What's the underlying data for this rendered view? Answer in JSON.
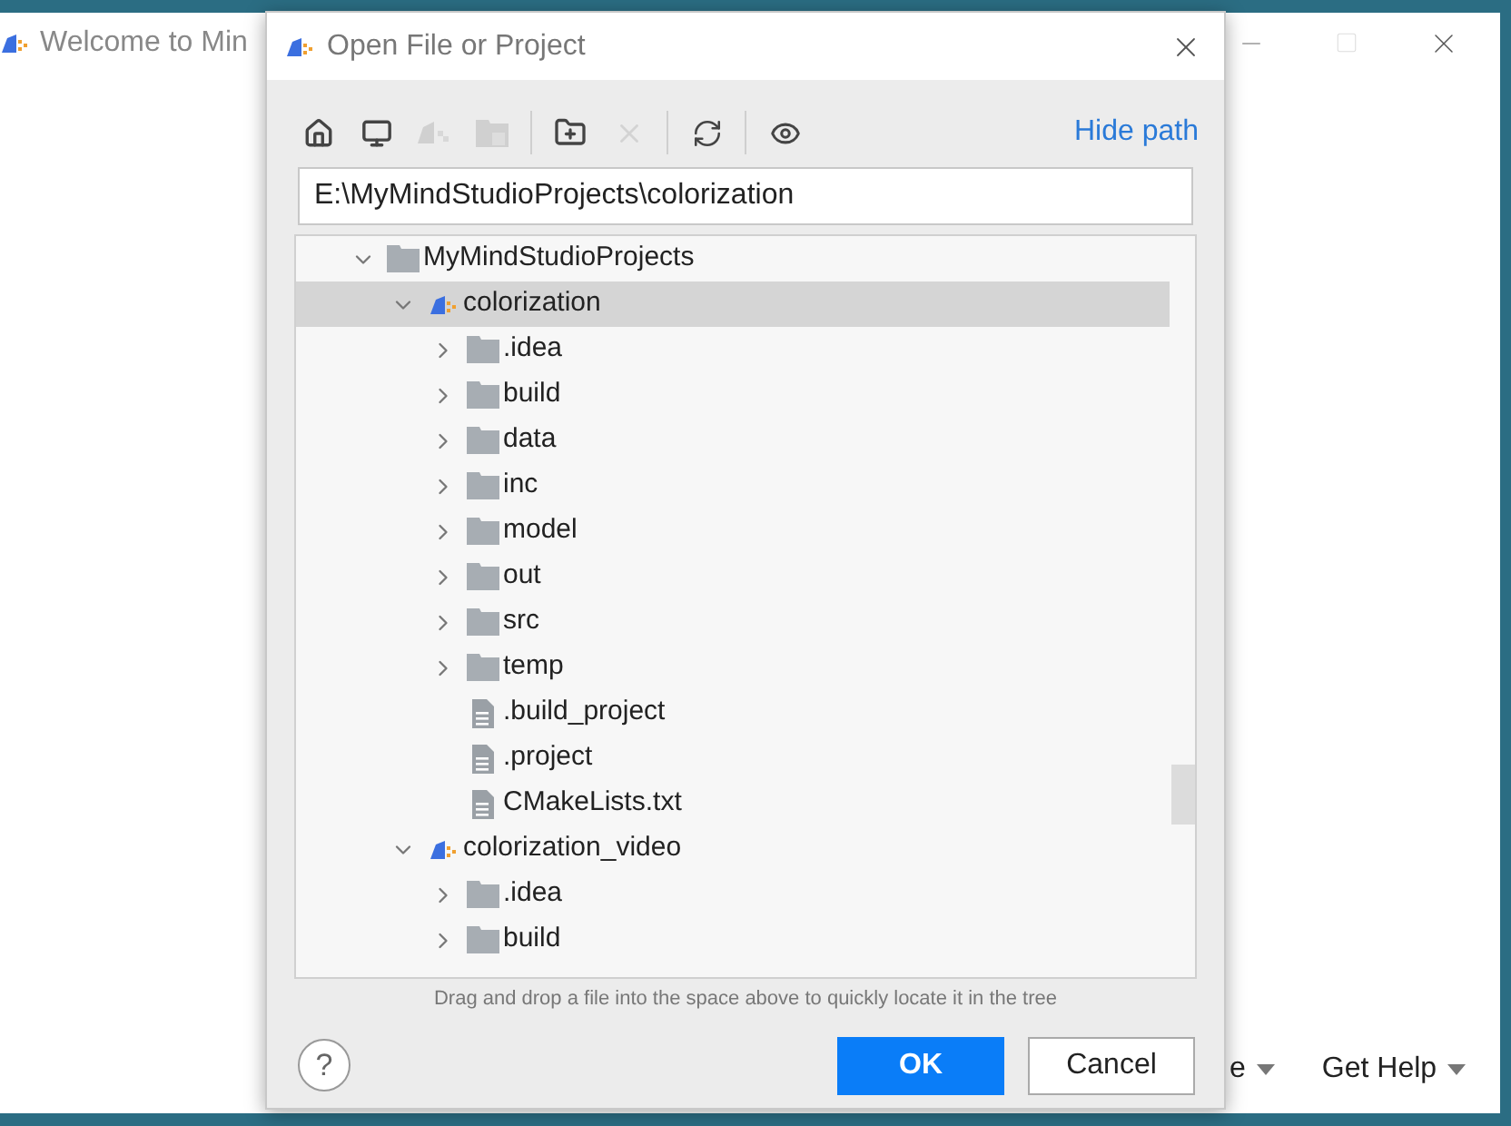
{
  "background_window": {
    "title": "Welcome to Min",
    "links": [
      {
        "label": "e"
      },
      {
        "label": "Get Help"
      }
    ]
  },
  "dialog": {
    "title": "Open File or Project",
    "toolbar": [
      {
        "disabled": false
      },
      {
        "disabled": false
      },
      {
        "disabled": true
      },
      {
        "disabled": true
      },
      {
        "disabled": false
      },
      {
        "disabled": true
      },
      {
        "disabled": false
      },
      {
        "disabled": false
      }
    ],
    "hide_path_link": "Hide path",
    "path": "E:\\MyMindStudioProjects\\colorization",
    "tree": [
      {
        "label": "MyMindStudioProjects",
        "kind": "folder",
        "expanded": true,
        "selected": false,
        "children": [
          {
            "label": "colorization",
            "kind": "module",
            "expanded": true,
            "selected": true,
            "children": [
              {
                "label": ".idea",
                "kind": "folder",
                "expanded": false,
                "selected": false
              },
              {
                "label": "build",
                "kind": "folder",
                "expanded": false,
                "selected": false
              },
              {
                "label": "data",
                "kind": "folder",
                "expanded": false,
                "selected": false
              },
              {
                "label": "inc",
                "kind": "folder",
                "expanded": false,
                "selected": false
              },
              {
                "label": "model",
                "kind": "folder",
                "expanded": false,
                "selected": false
              },
              {
                "label": "out",
                "kind": "folder",
                "expanded": false,
                "selected": false
              },
              {
                "label": "src",
                "kind": "folder",
                "expanded": false,
                "selected": false
              },
              {
                "label": "temp",
                "kind": "folder",
                "expanded": false,
                "selected": false
              },
              {
                "label": ".build_project",
                "kind": "file",
                "selected": false
              },
              {
                "label": ".project",
                "kind": "file",
                "selected": false
              },
              {
                "label": "CMakeLists.txt",
                "kind": "file",
                "selected": false
              }
            ]
          },
          {
            "label": "colorization_video",
            "kind": "module",
            "expanded": true,
            "selected": false,
            "children": [
              {
                "label": ".idea",
                "kind": "folder",
                "expanded": false,
                "selected": false
              },
              {
                "label": "build",
                "kind": "folder",
                "expanded": false,
                "selected": false
              }
            ]
          }
        ]
      }
    ],
    "hint": "Drag and drop a file into the space above to quickly locate it in the tree",
    "help_button": "?",
    "ok_button": "OK",
    "cancel_button": "Cancel"
  }
}
